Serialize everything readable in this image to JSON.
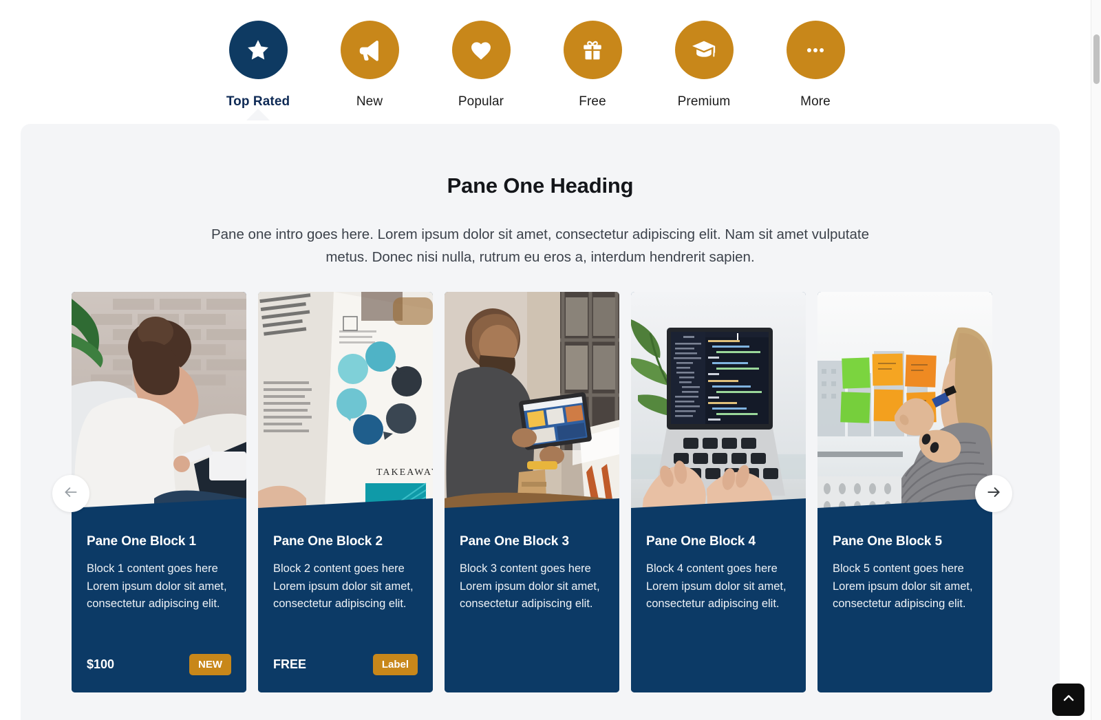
{
  "tabs": [
    {
      "label": "Top Rated",
      "icon": "star-icon",
      "active": true
    },
    {
      "label": "New",
      "icon": "megaphone-icon",
      "active": false
    },
    {
      "label": "Popular",
      "icon": "heart-icon",
      "active": false
    },
    {
      "label": "Free",
      "icon": "gift-icon",
      "active": false
    },
    {
      "label": "Premium",
      "icon": "graduation-cap-icon",
      "active": false
    },
    {
      "label": "More",
      "icon": "ellipsis-icon",
      "active": false
    }
  ],
  "pane": {
    "heading": "Pane One Heading",
    "intro": "Pane one intro goes here. Lorem ipsum dolor sit amet, consectetur adipiscing elit. Nam sit amet vulputate metus. Donec nisi nulla, rutrum eu eros a, interdum hendrerit sapien."
  },
  "cards": [
    {
      "title": "Pane One Block 1",
      "text": "Block 1 content goes here Lorem ipsum dolor sit amet, consectetur adipiscing elit.",
      "price": "$100",
      "badge": "NEW",
      "image": "woman-with-tablet-brick-wall"
    },
    {
      "title": "Pane One Block 2",
      "text": "Block 2 content goes here Lorem ipsum dolor sit amet, consectetur adipiscing elit.",
      "price": "FREE",
      "badge": "Label",
      "image": "open-book-mvp-diagram"
    },
    {
      "title": "Pane One Block 3",
      "text": "Block 3 content goes here Lorem ipsum dolor sit amet, consectetur adipiscing elit.",
      "price": "",
      "badge": "",
      "image": "man-with-tablet-at-easel"
    },
    {
      "title": "Pane One Block 4",
      "text": "Block 4 content goes here Lorem ipsum dolor sit amet, consectetur adipiscing elit.",
      "price": "",
      "badge": "",
      "image": "laptop-with-code-and-plant"
    },
    {
      "title": "Pane One Block 5",
      "text": "Block 5 content goes here Lorem ipsum dolor sit amet, consectetur adipiscing elit.",
      "price": "",
      "badge": "",
      "image": "woman-with-sticky-notes-window"
    }
  ],
  "carousel": {
    "prev_icon": "arrow-left-icon",
    "next_icon": "arrow-right-icon"
  },
  "back_to_top": {
    "icon": "chevron-up-icon"
  },
  "colors": {
    "navy": "#0c3a66",
    "navy_dark": "#0e3a62",
    "amber": "#c8871a",
    "pane_bg": "#f4f5f7",
    "page_bg": "#ffffff",
    "heading": "#14161a",
    "body_text": "#3c424b"
  }
}
